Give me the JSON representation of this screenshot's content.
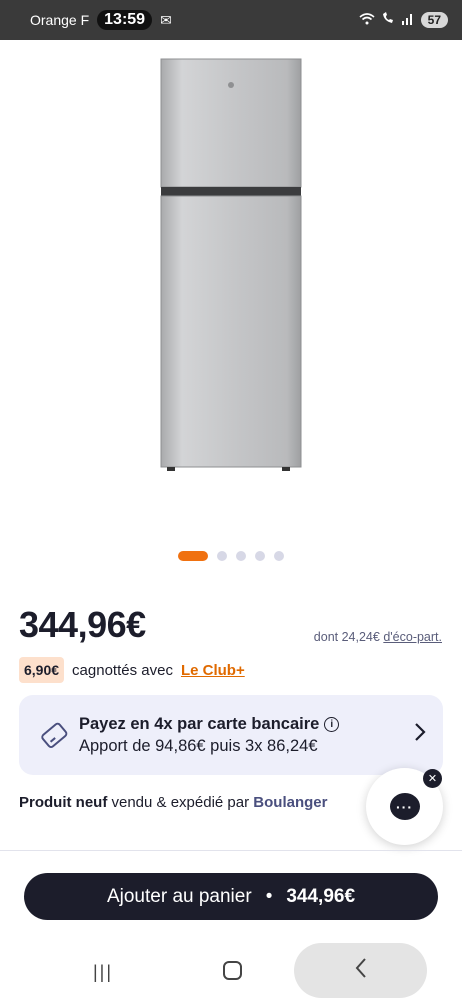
{
  "status_bar": {
    "carrier": "Orange F",
    "time": "13:59",
    "battery": "57"
  },
  "carousel": {
    "slides": 5,
    "active_index": 0
  },
  "product": {
    "price": "344,96€",
    "eco_prefix": "dont 24,24€",
    "eco_link": "d'éco-part."
  },
  "club": {
    "badge": "6,90€",
    "text": "cagnottés avec",
    "link": "Le Club+"
  },
  "payment": {
    "title": "Payez en 4x par carte bancaire",
    "subtitle": "Apport de 94,86€ puis 3x 86,24€"
  },
  "seller": {
    "bold": "Produit neuf",
    "middle": "vendu & expédié par",
    "brand": "Boulanger"
  },
  "cart": {
    "label": "Ajouter au panier",
    "separator": "•",
    "price": "344,96€"
  },
  "colors": {
    "accent_orange": "#f07110",
    "dark_navy": "#1c1d2b",
    "card_bg": "#eeeffa",
    "club_badge_bg": "#fde0cc"
  }
}
